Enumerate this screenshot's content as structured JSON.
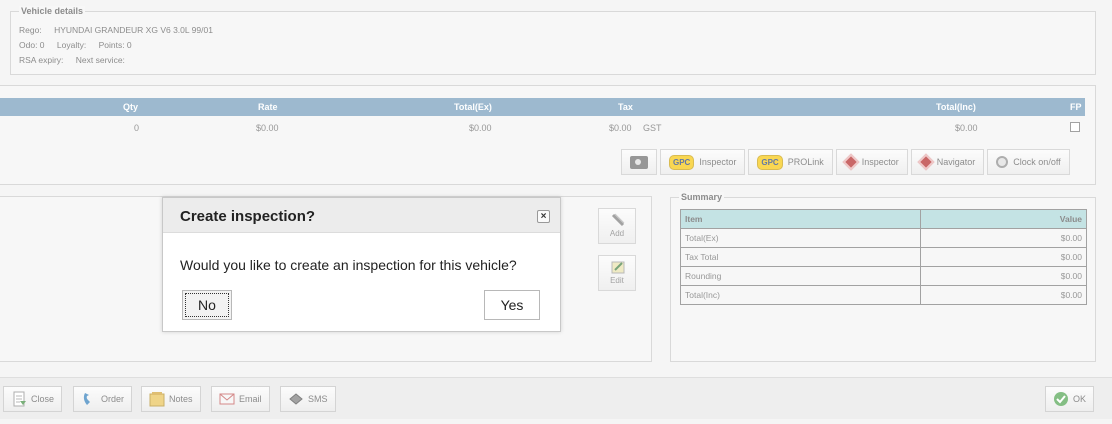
{
  "vehicle": {
    "legend": "Vehicle details",
    "rego_label": "Rego:",
    "rego_value": "HYUNDAI GRANDEUR XG V6 3.0L 99/01",
    "odo": "Odo: 0",
    "loyalty": "Loyalty:",
    "points": "Points: 0",
    "rsa": "RSA expiry:",
    "next_service": "Next service:"
  },
  "lines": {
    "headers": {
      "qty": "Qty",
      "rate": "Rate",
      "total_ex": "Total(Ex)",
      "tax": "Tax",
      "total_inc": "Total(Inc)",
      "fp": "FP"
    },
    "row": {
      "qty": "0",
      "rate": "$0.00",
      "total_ex": "$0.00",
      "tax": "$0.00",
      "tax_type": "GST",
      "total_inc": "$0.00"
    },
    "toolbar": {
      "gpc_badge": "GPC",
      "gpc_inspector": "Inspector",
      "gpc_prolink": "PROLink",
      "inspector": "Inspector",
      "navigator": "Navigator",
      "clock": "Clock on/off"
    }
  },
  "side": {
    "add": "Add",
    "edit": "Edit"
  },
  "summary": {
    "legend": "Summary",
    "col_item": "Item",
    "col_value": "Value",
    "rows": [
      {
        "item": "Total(Ex)",
        "value": "$0.00"
      },
      {
        "item": "Tax Total",
        "value": "$0.00"
      },
      {
        "item": "Rounding",
        "value": "$0.00"
      },
      {
        "item": "Total(Inc)",
        "value": "$0.00"
      }
    ]
  },
  "bottom": {
    "close": "Close",
    "order": "Order",
    "notes": "Notes",
    "email": "Email",
    "sms": "SMS",
    "ok": "OK"
  },
  "modal": {
    "title": "Create inspection?",
    "close_glyph": "×",
    "message": "Would you like to create an inspection for this vehicle?",
    "no": "No",
    "yes": "Yes"
  },
  "colors": {
    "table_header": "#6f99b8",
    "summary_header": "#a9d6d8"
  }
}
